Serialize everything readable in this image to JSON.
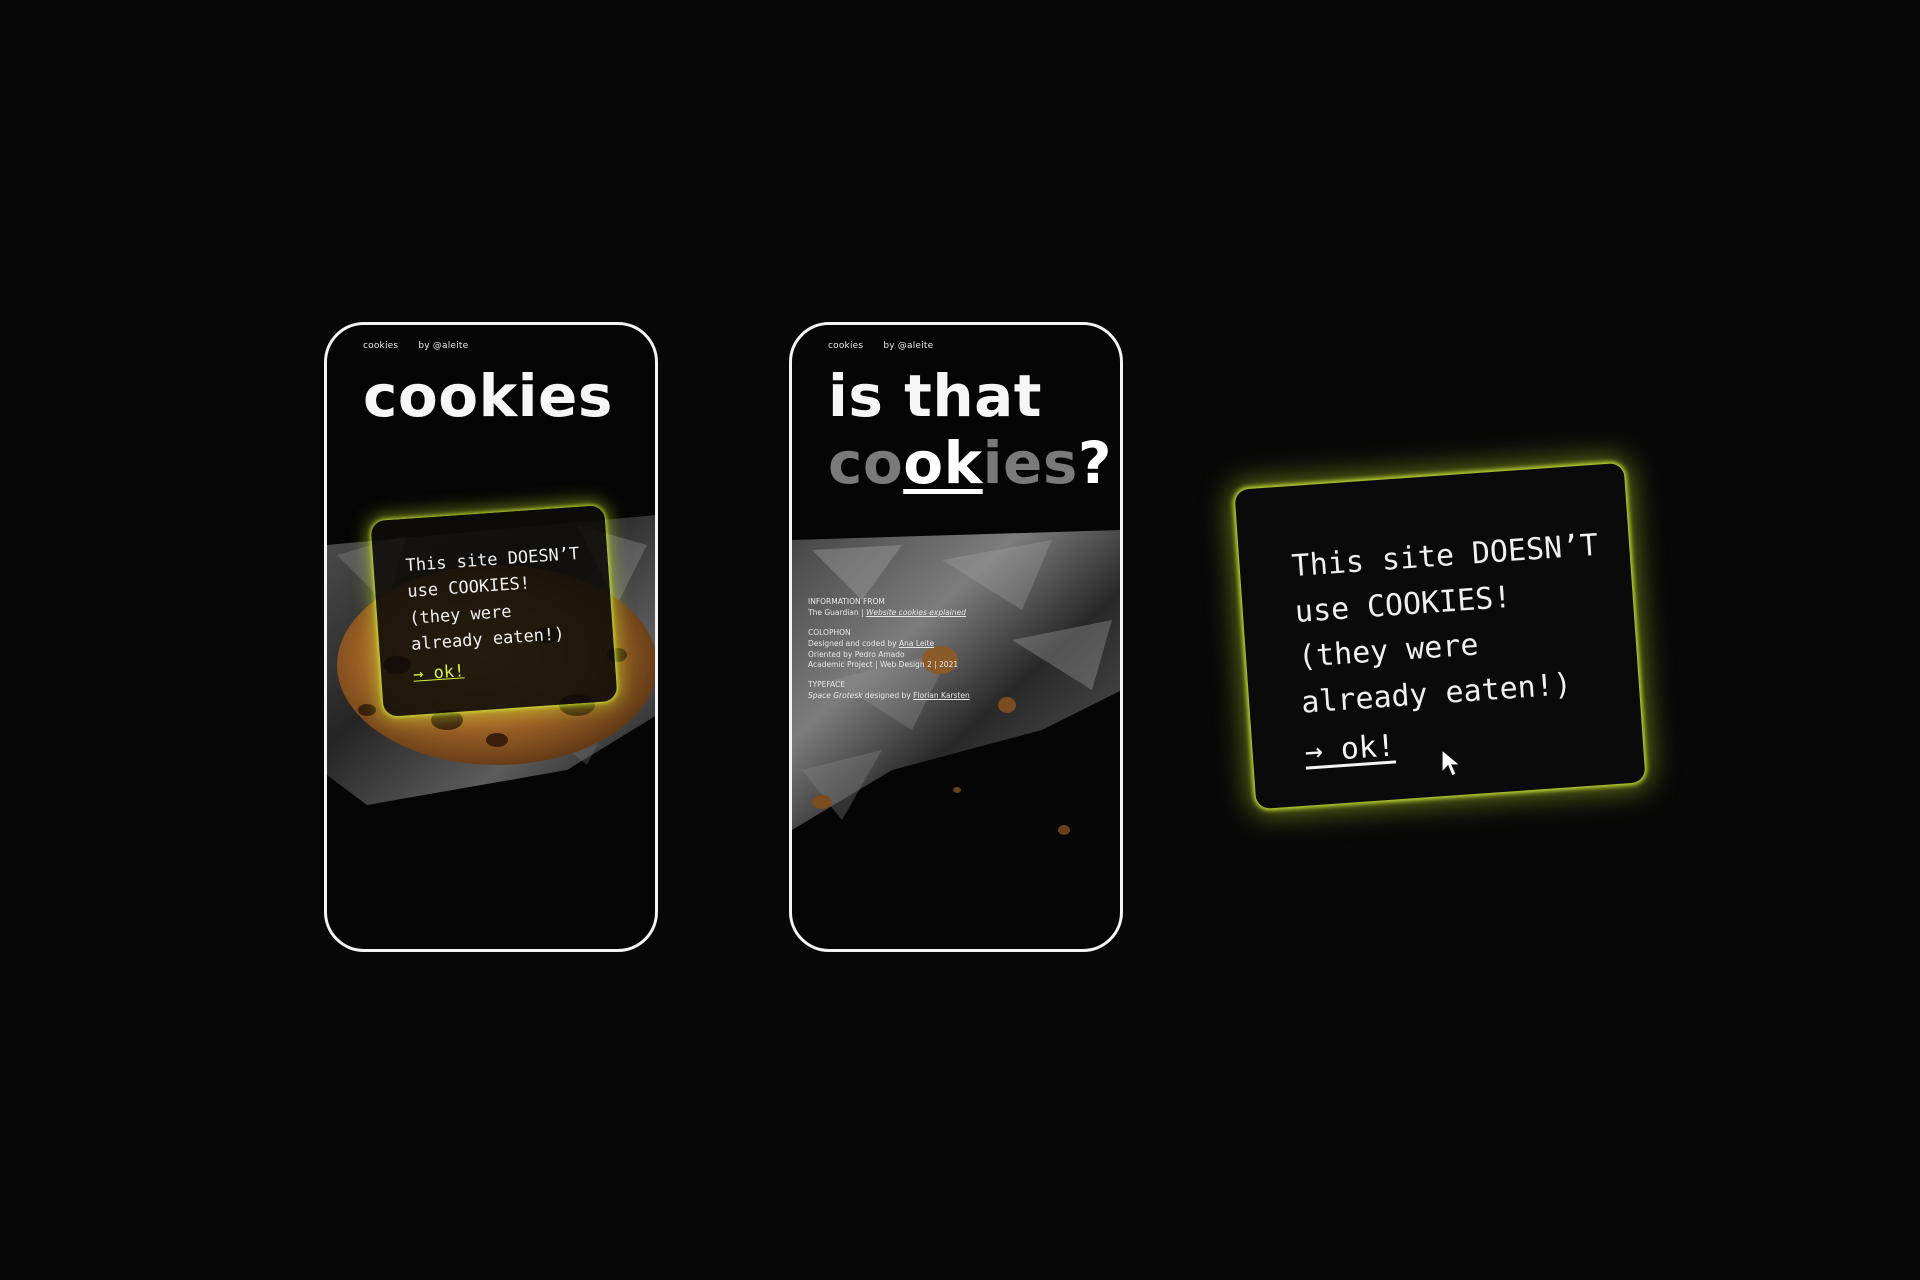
{
  "topbar": {
    "site_name": "cookies",
    "author": "by @aleite"
  },
  "screen1": {
    "title": "cookies"
  },
  "screen2": {
    "title_line1": "is that",
    "title_line2_pre": "co",
    "title_line2_ok": "ok",
    "title_line2_post": "ies",
    "title_line2_q": "?",
    "credits": {
      "info_heading": "INFORMATION FROM",
      "info_source": "The Guardian",
      "info_sep": " | ",
      "info_article": "Website cookies explained",
      "colophon_heading": "COLOPHON",
      "colophon_line1_pre": "Designed and coded by ",
      "colophon_line1_name": "Ana Leite",
      "colophon_line2": "Oriented by Pedro Amado",
      "colophon_line3": "Academic Project | Web Design 2 | 2021",
      "typeface_heading": "TYPEFACE",
      "typeface_name": "Space Grotesk",
      "typeface_mid": " designed by ",
      "typeface_designer": "Florian Karsten"
    }
  },
  "card": {
    "line1": "This site DOESN’T",
    "line2": "use COOKIES!",
    "line3": "(they were",
    "line4": "already eaten!)",
    "ok_label": "→ ok!"
  },
  "colors": {
    "accent": "#d6f23a",
    "background": "#080808"
  },
  "icons": [
    "cursor-arrow-icon"
  ]
}
